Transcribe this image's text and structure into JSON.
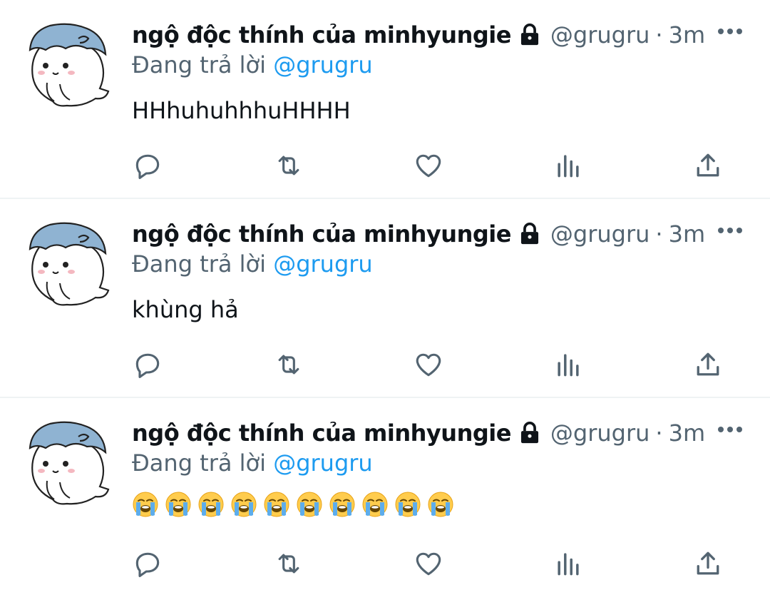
{
  "tweets": [
    {
      "display_name": "ngộ độc thính của minhyungie",
      "handle": "@grugru",
      "separator": "·",
      "time": "3m",
      "reply_prefix": "Đang trả lời",
      "reply_mention": "@grugru",
      "text": "HHhuhuhhhuHHHH",
      "emoji_count": 0
    },
    {
      "display_name": "ngộ độc thính của minhyungie",
      "handle": "@grugru",
      "separator": "·",
      "time": "3m",
      "reply_prefix": "Đang trả lời",
      "reply_mention": "@grugru",
      "text": "khùng hả",
      "emoji_count": 0
    },
    {
      "display_name": "ngộ độc thính của minhyungie",
      "handle": "@grugru",
      "separator": "·",
      "time": "3m",
      "reply_prefix": "Đang trả lời",
      "reply_mention": "@grugru",
      "text": "",
      "emoji": "loudly-crying-face",
      "emoji_count": 10
    }
  ],
  "icons": {
    "lock": "lock-icon",
    "more": "more-icon",
    "reply": "reply-icon",
    "retweet": "retweet-icon",
    "like": "heart-icon",
    "views": "views-icon",
    "share": "share-icon"
  },
  "colors": {
    "text": "#0f1419",
    "secondary": "#536471",
    "accent": "#1d9bf0",
    "divider": "#eff3f4",
    "avatar_hair": "#8fb3d2"
  }
}
